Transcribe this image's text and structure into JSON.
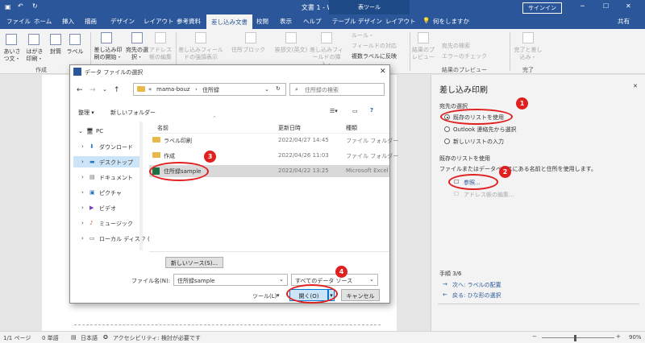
{
  "titlebar": {
    "title": "文書 1 - Word",
    "context_tab": "表ツール",
    "signin": "サインイン"
  },
  "tabs": [
    "ファイル",
    "ホーム",
    "挿入",
    "描画",
    "デザイン",
    "レイアウト",
    "参考資料",
    "差し込み文書",
    "校閲",
    "表示",
    "ヘルプ",
    "テーブル デザイン",
    "レイアウト"
  ],
  "tellme": "何をしますか",
  "share": "共有",
  "ribbon": {
    "btns": [
      "あいさつ文・",
      "はがき印刷・",
      "封筒",
      "ラベル",
      "差し込み印刷の開始・",
      "宛先の選択・",
      "アドレス帳の編集",
      "差し込みフィールドの強調表示",
      "住所ブロック",
      "挨拶文(英文)",
      "差し込みフィールドの挿入・",
      "ルール・",
      "フィールドの対応",
      "複数ラベルに反映",
      "結果のプレビュー",
      "宛先の検索",
      "エラーのチェック",
      "完了と差し込み・"
    ],
    "groups": [
      "作成",
      "結果のプレビュー",
      "完了"
    ]
  },
  "pane": {
    "title": "差し込み印刷",
    "section1": "宛先の選択",
    "options": [
      "既存のリストを使用",
      "Outlook 連絡先から選択",
      "新しいリストの入力"
    ],
    "section2": "既存のリストを使用",
    "desc": "ファイルまたはデータベースにある名前と住所を使用します。",
    "browse": "参照...",
    "edit": "アドレス帳の編集...",
    "step": "手順 3/6",
    "next": "次へ: ラベルの配置",
    "back": "戻る: ひな形の選択"
  },
  "dialog": {
    "title": "データ ファイルの選択",
    "path": [
      "mama-bouz",
      "住所録"
    ],
    "search_placeholder": "住所録の検索",
    "organize": "整理 ▾",
    "newfolder": "新しいフォルダー",
    "nav": [
      "PC",
      "ダウンロード",
      "デスクトップ",
      "ドキュメント",
      "ピクチャ",
      "ビデオ",
      "ミュージック",
      "ローカル ディスク ("
    ],
    "columns": [
      "名前",
      "更新日時",
      "種類"
    ],
    "files": [
      {
        "name": "ラベル印刷",
        "date": "2022/04/27 14:45",
        "type": "ファイル フォルダー"
      },
      {
        "name": "作成",
        "date": "2022/04/26 11:03",
        "type": "ファイル フォルダー"
      },
      {
        "name": "住所録sample",
        "date": "2022/04/22 13:25",
        "type": "Microsoft Excel"
      }
    ],
    "newsource": "新しいソース(S)...",
    "filename_label": "ファイル名(N):",
    "filename_value": "住所録sample",
    "filetype": "すべてのデータ ソース",
    "tools": "ツール(L)",
    "open": "開く(O)",
    "cancel": "キャンセル"
  },
  "badges": [
    "1",
    "2",
    "3",
    "4"
  ],
  "status": {
    "page": "1/1 ページ",
    "words": "0 単語",
    "lang": "日本語",
    "access": "アクセシビリティ: 検討が必要です",
    "zoom": "90%"
  },
  "colors": {
    "word_blue": "#2b579a",
    "highlight_red": "#e0201f"
  }
}
